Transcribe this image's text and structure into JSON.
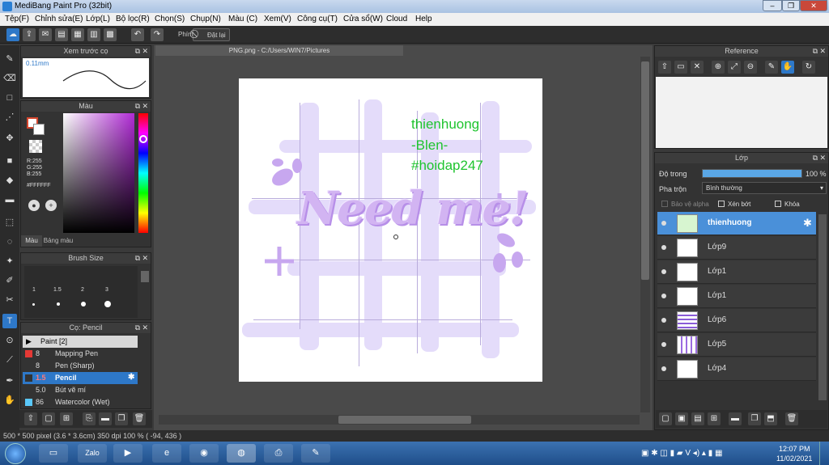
{
  "window": {
    "title": "MediBang Paint Pro (32bit)"
  },
  "menu": [
    "Tệp(F)",
    "Chỉnh sửa(E)",
    "Lớp(L)",
    "Bộ lọc(R)",
    "Chọn(S)",
    "Chụp(N)",
    "Màu (C)",
    "Xem(V)",
    "Công cụ(T)",
    "Cửa sổ(W)",
    "Cloud",
    "Help"
  ],
  "toolbar": {
    "phim_label": "Phím",
    "reset_label": "Đặt lại"
  },
  "preview_panel": {
    "title": "Xem trước cọ",
    "size": "0.11mm"
  },
  "color_panel": {
    "title": "Màu",
    "r": "R:255",
    "g": "G:255",
    "b": "B:255",
    "hex": "#FFFFFF",
    "tab_color": "Màu",
    "tab_palette": "Bảng màu",
    "accent": "#d4462e"
  },
  "brushsize_panel": {
    "title": "Brush Size",
    "sizes": [
      "1",
      "1.5",
      "2",
      "3"
    ]
  },
  "brush_panel": {
    "title": "Cọ: Pencil",
    "group": "Paint [2]",
    "items": [
      {
        "size": "8",
        "name": "Mapping Pen",
        "color": "#e53935"
      },
      {
        "size": "8",
        "name": "Pen (Sharp)",
        "color": "#333333"
      },
      {
        "size": "1.5",
        "name": "Pencil",
        "color": "#333333"
      },
      {
        "size": "5.0",
        "name": "Bút vẽ mí",
        "color": "#333333"
      },
      {
        "size": "86",
        "name": "Watercolor (Wet)",
        "color": "#5ac8fa"
      }
    ]
  },
  "document": {
    "tab": "PNG.png - C:/Users/WIN7/Pictures",
    "artwork_text": "Need me!",
    "watermark": [
      "thienhuong",
      "-Blen-",
      "#hoidap247"
    ]
  },
  "reference_panel": {
    "title": "Reference"
  },
  "layer_panel": {
    "title": "Lớp",
    "opacity_label": "Độ trong",
    "opacity_value": "100 %",
    "opacity": 1.0,
    "blend_label": "Pha trộn",
    "blend_value": "Bình thường",
    "protect_alpha": "Bảo vệ alpha",
    "clip": "Xén bớt",
    "lock": "Khóa",
    "layers": [
      "thienhuong",
      "Lớp9",
      "Lớp1",
      "Lớp1",
      "Lớp6",
      "Lớp5",
      "Lớp4"
    ]
  },
  "status": {
    "text": "500 * 500 pixel  (3.6 * 3.6cm)  350 dpi  100 %  ( -94, 436 )"
  },
  "taskbar": {
    "time": "12:07 PM",
    "date": "11/02/2021",
    "zalo": "Zalo"
  }
}
